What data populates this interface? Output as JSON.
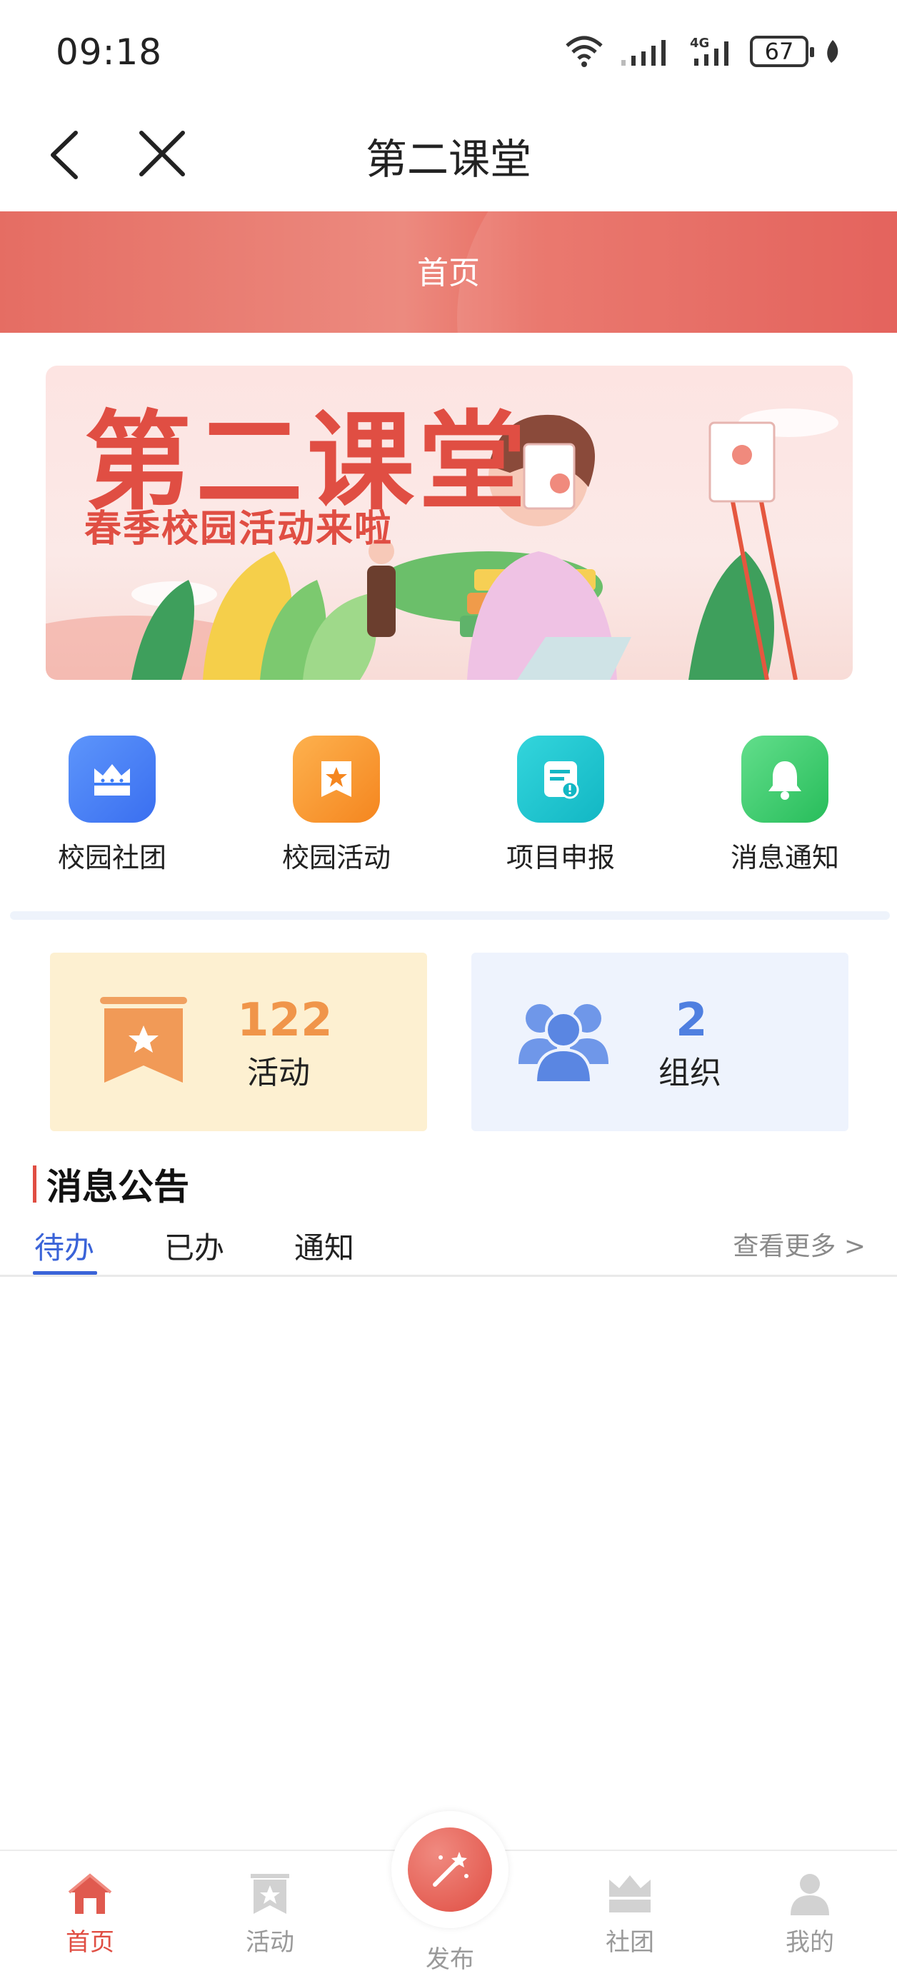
{
  "status_bar": {
    "time": "09:18",
    "battery": "67",
    "network": "4G"
  },
  "nav": {
    "title": "第二课堂"
  },
  "header": {
    "title": "首页"
  },
  "banner": {
    "title": "第二课堂",
    "subtitle": "春季校园活动来啦"
  },
  "quick_menu": [
    {
      "label": "校园社团",
      "icon": "crown-icon",
      "color": "#3d7cf6"
    },
    {
      "label": "校园活动",
      "icon": "star-bookmark-icon",
      "color": "#f6922c"
    },
    {
      "label": "项目申报",
      "icon": "document-alert-icon",
      "color": "#1bc3cf"
    },
    {
      "label": "消息通知",
      "icon": "bell-icon",
      "color": "#35c86a"
    }
  ],
  "stats": {
    "activity": {
      "value": "122",
      "label": "活动"
    },
    "org": {
      "value": "2",
      "label": "组织"
    }
  },
  "notices": {
    "title": "消息公告",
    "tabs": [
      "待办",
      "已办",
      "通知"
    ],
    "active_tab": "待办",
    "more": "查看更多 >"
  },
  "bottom_nav": {
    "items": [
      "首页",
      "活动",
      "发布",
      "社团",
      "我的"
    ],
    "active": "首页"
  },
  "colors": {
    "accent_red": "#e04e43",
    "accent_blue": "#3a63d8"
  }
}
